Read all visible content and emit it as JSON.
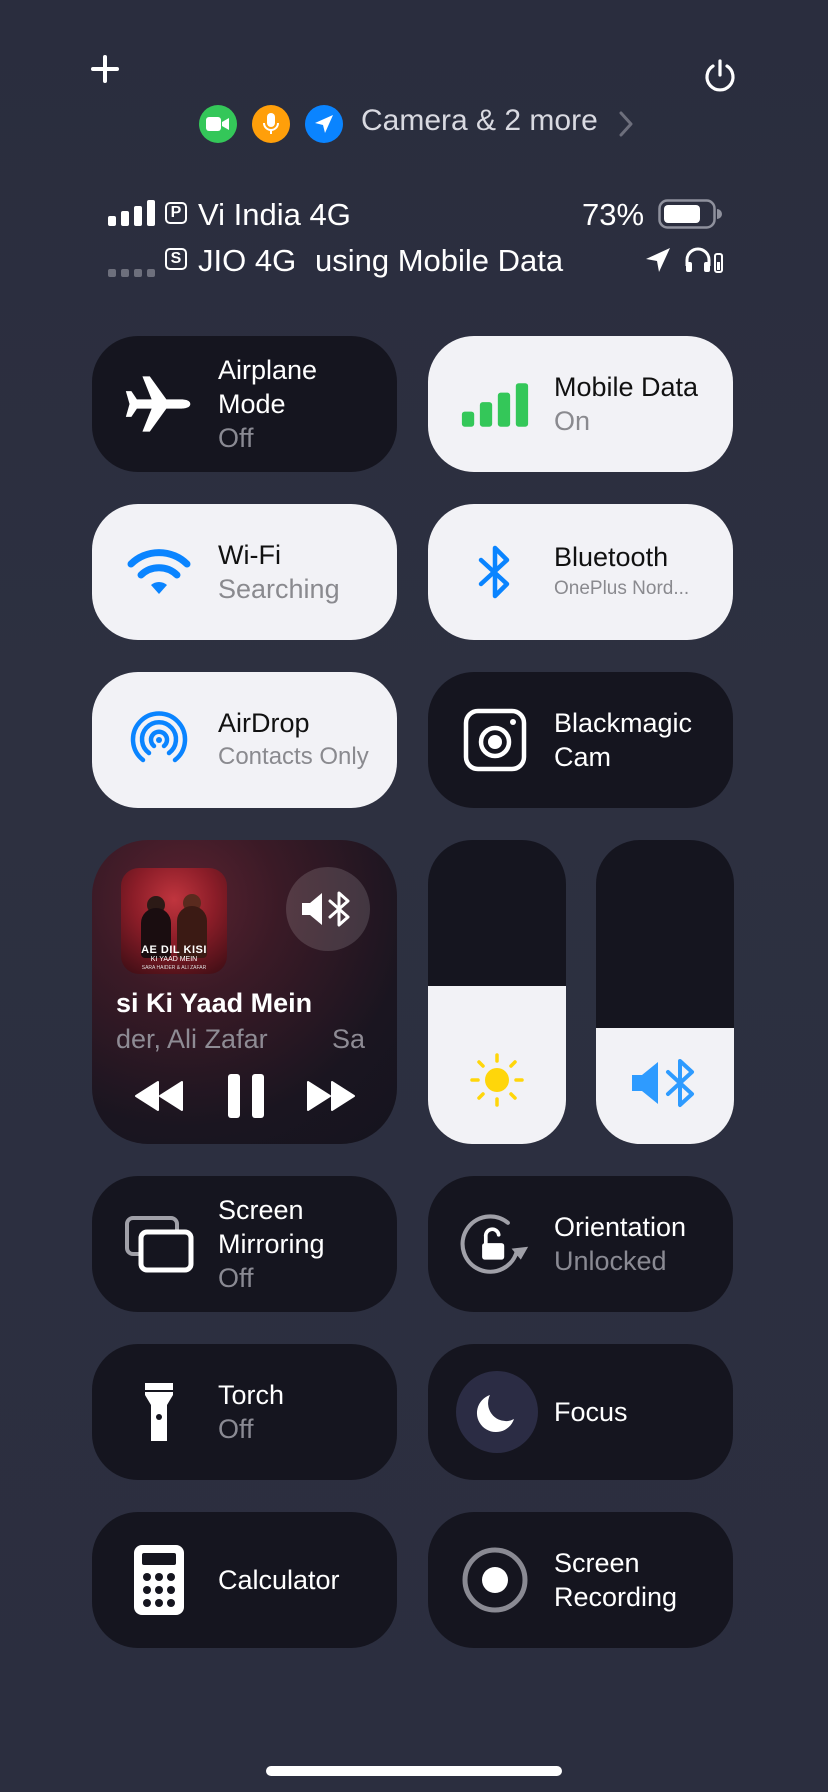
{
  "top": {
    "privacy_text": "Camera & 2 more",
    "privacy_icons": [
      "camera-icon",
      "microphone-icon",
      "location-icon"
    ]
  },
  "status": {
    "sim1_badge": "P",
    "sim1_carrier": "Vi India 4G",
    "battery": "73%",
    "battery_level": 0.73,
    "sim2_badge": "S",
    "sim2_carrier": "JIO 4G",
    "sim2_note": "using Mobile Data"
  },
  "tiles": {
    "airplane": {
      "title_1": "Airplane",
      "title_2": "Mode",
      "sub": "Off"
    },
    "mobile_data": {
      "title": "Mobile Data",
      "sub": "On"
    },
    "wifi": {
      "title": "Wi-Fi",
      "sub": "Searching"
    },
    "bluetooth": {
      "title": "Bluetooth",
      "sub": "OnePlus Nord..."
    },
    "airdrop": {
      "title": "AirDrop",
      "sub": "Contacts Only"
    },
    "blackmagic": {
      "title_1": "Blackmagic",
      "title_2": "Cam"
    },
    "mirroring": {
      "title_1": "Screen",
      "title_2": "Mirroring",
      "sub": "Off"
    },
    "orientation": {
      "title": "Orientation",
      "sub": "Unlocked"
    },
    "torch": {
      "title": "Torch",
      "sub": "Off"
    },
    "focus": {
      "title": "Focus"
    },
    "calculator": {
      "title": "Calculator"
    },
    "recording": {
      "title_1": "Screen",
      "title_2": "Recording"
    }
  },
  "media": {
    "album_title_1": "AE DIL KISI",
    "album_title_2": "KI YAAD MEIN",
    "album_artists": "SARA HAIDER & ALI ZAFAR",
    "song": "si Ki Yaad Mein",
    "artist": "der, Ali Zafar",
    "artist_next": "Sa"
  },
  "sliders": {
    "brightness_level": 0.52,
    "volume_level": 0.38
  },
  "colors": {
    "green": "#34c759",
    "orange": "#ff9f0a",
    "blue": "#0a84ff",
    "bt_blue": "#2e9bff",
    "sun_yellow": "#ffd60a"
  }
}
